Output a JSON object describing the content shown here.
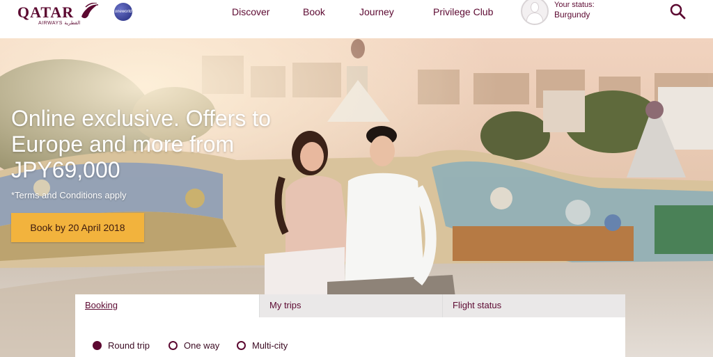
{
  "header": {
    "logo_text": "QATAR",
    "logo_sub": "AIRWAYS القطرية",
    "oneworld_text": "oneworld",
    "nav": [
      "Discover",
      "Book",
      "Journey",
      "Privilege Club"
    ],
    "status_label": "Your status:",
    "status_value": "Burgundy",
    "search_icon": "search-icon"
  },
  "hero": {
    "headline": "Online exclusive. Offers to Europe and more from JPY69,000",
    "terms": "*Terms and Conditions apply",
    "cta_label": "Book by 20 April 2018"
  },
  "booking_widget": {
    "tabs": [
      "Booking",
      "My trips",
      "Flight status"
    ],
    "active_tab": "Booking",
    "trip_types": [
      "Round trip",
      "One way",
      "Multi-city"
    ],
    "selected_trip_type": "Round trip"
  },
  "colors": {
    "brand": "#5c0931",
    "cta": "#f2b33d",
    "tab_inactive": "#eae8e8"
  }
}
